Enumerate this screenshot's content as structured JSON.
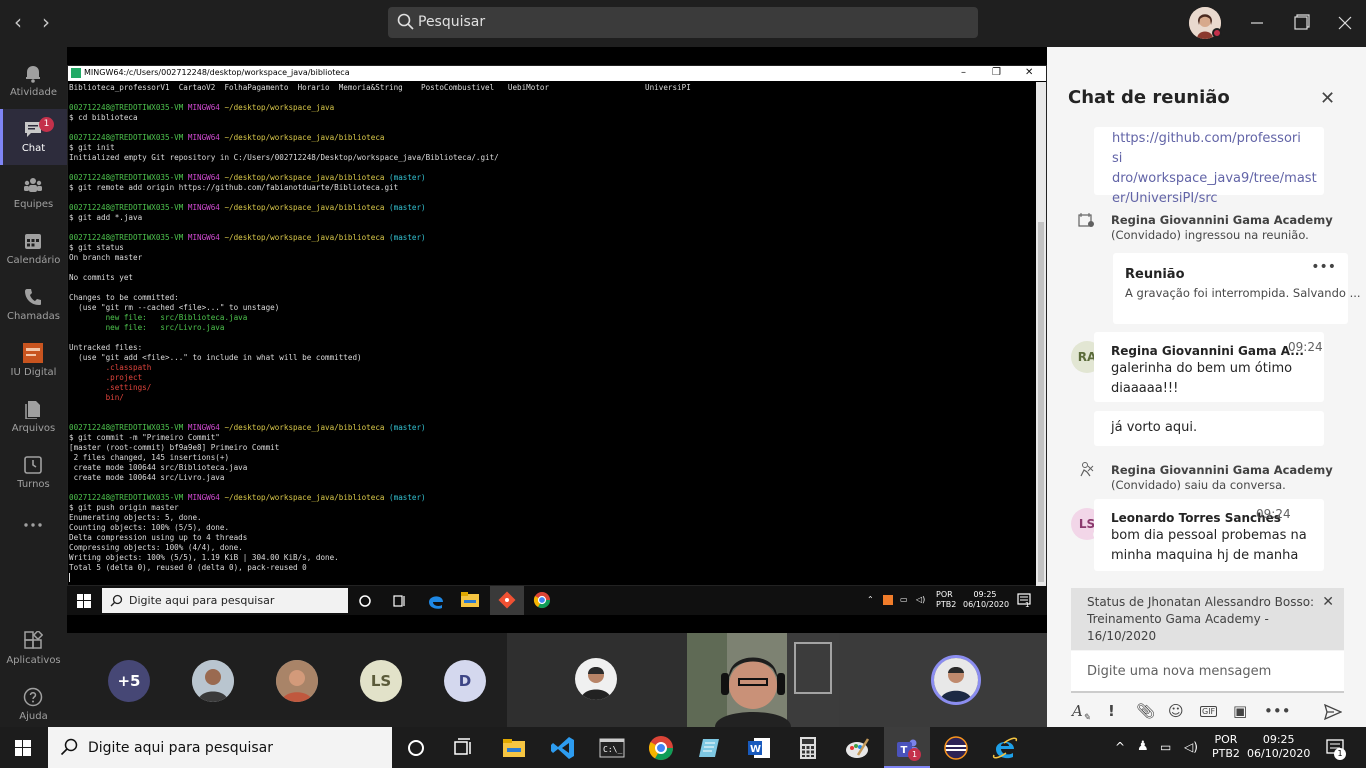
{
  "topbar": {
    "search_placeholder": "Pesquisar"
  },
  "rail": {
    "items": [
      {
        "label": "Atividade"
      },
      {
        "label": "Chat",
        "badge": "1"
      },
      {
        "label": "Equipes"
      },
      {
        "label": "Calendário"
      },
      {
        "label": "Chamadas"
      },
      {
        "label": "IU Digital"
      },
      {
        "label": "Arquivos"
      },
      {
        "label": "Turnos"
      },
      {
        "label": "Aplicativos"
      },
      {
        "label": "Ajuda"
      }
    ]
  },
  "terminal": {
    "title": "MINGW64:/c/Users/002712248/desktop/workspace_java/biblioteca",
    "lines": [
      [
        [
          "Biblioteca_professorV1  CartaoV2  FolhaPagamento  Horario  Memoria&String    PostoCombustivel   UebiMotor                     UniversiPI",
          ""
        ]
      ],
      [
        [
          "",
          ""
        ]
      ],
      [
        [
          "002712248@TREDOTIWX035-VM ",
          "g"
        ],
        [
          "MINGW64 ",
          "m"
        ],
        [
          "~/desktop/workspace_java",
          "y"
        ]
      ],
      [
        [
          "$ cd biblioteca",
          ""
        ]
      ],
      [
        [
          "",
          ""
        ]
      ],
      [
        [
          "002712248@TREDOTIWX035-VM ",
          "g"
        ],
        [
          "MINGW64 ",
          "m"
        ],
        [
          "~/desktop/workspace_java/biblioteca",
          "y"
        ]
      ],
      [
        [
          "$ git init",
          ""
        ]
      ],
      [
        [
          "Initialized empty Git repository in C:/Users/002712248/Desktop/workspace_java/Biblioteca/.git/",
          ""
        ]
      ],
      [
        [
          "",
          ""
        ]
      ],
      [
        [
          "002712248@TREDOTIWX035-VM ",
          "g"
        ],
        [
          "MINGW64 ",
          "m"
        ],
        [
          "~/desktop/workspace_java/biblioteca ",
          "y"
        ],
        [
          "(master)",
          "c"
        ]
      ],
      [
        [
          "$ git remote add origin https://github.com/fabianotduarte/Biblioteca.git",
          ""
        ]
      ],
      [
        [
          "",
          ""
        ]
      ],
      [
        [
          "002712248@TREDOTIWX035-VM ",
          "g"
        ],
        [
          "MINGW64 ",
          "m"
        ],
        [
          "~/desktop/workspace_java/biblioteca ",
          "y"
        ],
        [
          "(master)",
          "c"
        ]
      ],
      [
        [
          "$ git add *.java",
          ""
        ]
      ],
      [
        [
          "",
          ""
        ]
      ],
      [
        [
          "002712248@TREDOTIWX035-VM ",
          "g"
        ],
        [
          "MINGW64 ",
          "m"
        ],
        [
          "~/desktop/workspace_java/biblioteca ",
          "y"
        ],
        [
          "(master)",
          "c"
        ]
      ],
      [
        [
          "$ git status",
          ""
        ]
      ],
      [
        [
          "On branch master",
          ""
        ]
      ],
      [
        [
          "",
          ""
        ]
      ],
      [
        [
          "No commits yet",
          ""
        ]
      ],
      [
        [
          "",
          ""
        ]
      ],
      [
        [
          "Changes to be committed:",
          ""
        ]
      ],
      [
        [
          "  (use \"git rm --cached <file>...\" to unstage)",
          ""
        ]
      ],
      [
        [
          "        new file:   src/Biblioteca.java",
          "g"
        ]
      ],
      [
        [
          "        new file:   src/Livro.java",
          "g"
        ]
      ],
      [
        [
          "",
          ""
        ]
      ],
      [
        [
          "Untracked files:",
          ""
        ]
      ],
      [
        [
          "  (use \"git add <file>...\" to include in what will be committed)",
          ""
        ]
      ],
      [
        [
          "        .classpath",
          "r"
        ]
      ],
      [
        [
          "        .project",
          "r"
        ]
      ],
      [
        [
          "        .settings/",
          "r"
        ]
      ],
      [
        [
          "        bin/",
          "r"
        ]
      ],
      [
        [
          "",
          ""
        ]
      ],
      [
        [
          "",
          ""
        ]
      ],
      [
        [
          "002712248@TREDOTIWX035-VM ",
          "g"
        ],
        [
          "MINGW64 ",
          "m"
        ],
        [
          "~/desktop/workspace_java/biblioteca ",
          "y"
        ],
        [
          "(master)",
          "c"
        ]
      ],
      [
        [
          "$ git commit -m \"Primeiro Commit\"",
          ""
        ]
      ],
      [
        [
          "[master (root-commit) bf9a9e8] Primeiro Commit",
          ""
        ]
      ],
      [
        [
          " 2 files changed, 145 insertions(+)",
          ""
        ]
      ],
      [
        [
          " create mode 100644 src/Biblioteca.java",
          ""
        ]
      ],
      [
        [
          " create mode 100644 src/Livro.java",
          ""
        ]
      ],
      [
        [
          "",
          ""
        ]
      ],
      [
        [
          "002712248@TREDOTIWX035-VM ",
          "g"
        ],
        [
          "MINGW64 ",
          "m"
        ],
        [
          "~/desktop/workspace_java/biblioteca ",
          "y"
        ],
        [
          "(master)",
          "c"
        ]
      ],
      [
        [
          "$ git push origin master",
          ""
        ]
      ],
      [
        [
          "Enumerating objects: 5, done.",
          ""
        ]
      ],
      [
        [
          "Counting objects: 100% (5/5), done.",
          ""
        ]
      ],
      [
        [
          "Delta compression using up to 4 threads",
          ""
        ]
      ],
      [
        [
          "Compressing objects: 100% (4/4), done.",
          ""
        ]
      ],
      [
        [
          "Writing objects: 100% (5/5), 1.19 KiB | 304.00 KiB/s, done.",
          ""
        ]
      ],
      [
        [
          "Total 5 (delta 0), reused 0 (delta 0), pack-reused 0",
          ""
        ]
      ]
    ]
  },
  "remote_taskbar": {
    "search_placeholder": "Digite aqui para pesquisar",
    "lang": "POR",
    "lang2": "PTB2",
    "time": "09:25",
    "date": "06/10/2020",
    "notifications": "1"
  },
  "participants": {
    "overflow": "+5",
    "initials_1": "LS",
    "initials_2": "D"
  },
  "chat": {
    "title": "Chat de reunião",
    "link_text": "https://github.com/professorisidro/workspace_java9/tree/master/UniversiPI/src",
    "link_line1": "https://github.com/professori si",
    "link_line2": "dro/workspace_java9/tree/mast",
    "link_line3": "er/UniversiPI/src",
    "join_event": {
      "name": "Regina Giovannini Gama Academy",
      "text": "(Convidado) ingressou na reunião."
    },
    "recording_card": {
      "title": "Reunião",
      "text": "A gravação foi interrompida. Salvando ..."
    },
    "messages": [
      {
        "initials": "RA",
        "name": "Regina Giovannini Gama A...",
        "time": "09:24",
        "line1": "galerinha do bem um ótimo",
        "line2": "diaaaaa!!!"
      },
      {
        "text": "já vorto aqui."
      }
    ],
    "leave_event": {
      "name": "Regina Giovannini Gama Academy",
      "text": "(Convidado) saiu da conversa."
    },
    "message2": {
      "initials": "LS",
      "name": "Leonardo Torres Sanches",
      "time": "09:24",
      "line1": "bom dia pessoal probemas na",
      "line2": "minha maquina hj de manha"
    },
    "status": {
      "line1": "Status de Jhonatan Alessandro Bosso:",
      "line2": "Treinamento Gama Academy -",
      "line3": "16/10/2020"
    },
    "compose_placeholder": "Digite uma nova mensagem"
  },
  "local_taskbar": {
    "search_placeholder": "Digite aqui para pesquisar",
    "teams_badge": "1",
    "lang": "POR",
    "lang2": "PTB2",
    "time": "09:25",
    "date": "06/10/2020",
    "notifications": "1"
  },
  "colors": {
    "accent": "#6264a7",
    "rail_bg": "#1f1f1f",
    "chat_bg": "#f5f5f5",
    "alert": "#c4314b"
  }
}
